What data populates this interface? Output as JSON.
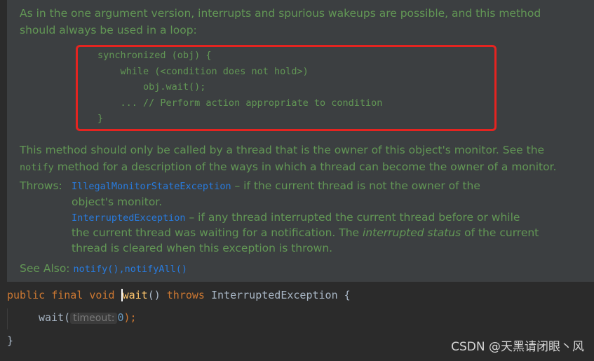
{
  "doc": {
    "intro_line1": "As in the one argument version, interrupts and spurious wakeups are possible, and this method",
    "intro_line2": "should always be used in a loop:",
    "code": {
      "line1": "synchronized (obj) {",
      "line2": "    while (<condition does not hold>)",
      "line3": "        obj.wait();",
      "line4": "    ... // Perform action appropriate to condition",
      "line5": "}"
    },
    "owner_line1": "This method should only be called by a thread that is the owner of this object's monitor. See the",
    "owner_notify": "notify",
    "owner_line2_rest": " method for a description of the ways in which a thread can become the owner of a monitor.",
    "throws_label": "Throws:",
    "throws1_link": "IllegalMonitorStateException",
    "throws1_text": " – if the current thread is not the owner of the",
    "throws1_text2": "object's monitor.",
    "throws2_link": "InterruptedException",
    "throws2_text": " – if any thread interrupted the current thread before or while",
    "throws2_text2_a": "the current thread was waiting for a notification. The ",
    "throws2_text2_italic": "interrupted status",
    "throws2_text2_b": " of the current",
    "throws2_text3": "thread is cleared when this exception is thrown.",
    "see_also_label": "See Also:",
    "see_also_1": "notify()",
    "see_also_sep": ",",
    "see_also_2": "notifyAll()"
  },
  "editor": {
    "kw_public": "public",
    "kw_final": "final",
    "kw_void": "void",
    "method_name": "wait",
    "parens": "()",
    "kw_throws": "throws",
    "exception": "InterruptedException",
    "open_brace": "{",
    "call_name": "wait(",
    "hint_label": "timeout:",
    "call_arg": "0",
    "call_end": ");",
    "close_brace": "}"
  },
  "watermark": "CSDN @天黑请闭眼丶风"
}
